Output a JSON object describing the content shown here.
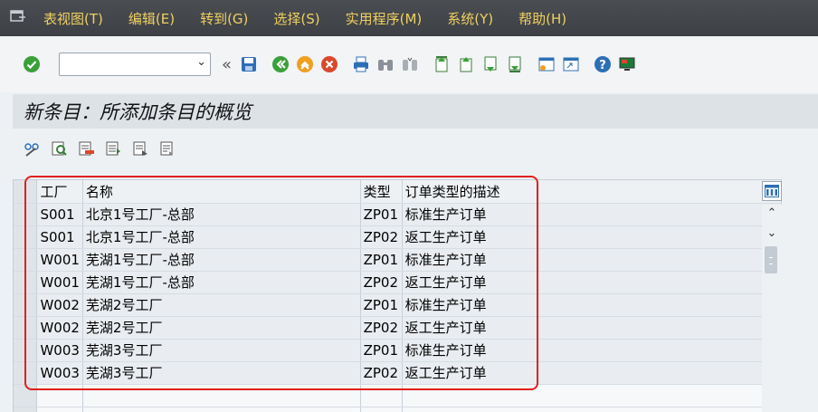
{
  "menu": {
    "items": [
      {
        "label": "表视图(T)"
      },
      {
        "label": "编辑(E)"
      },
      {
        "label": "转到(G)"
      },
      {
        "label": "选择(S)"
      },
      {
        "label": "实用程序(M)"
      },
      {
        "label": "系统(Y)"
      },
      {
        "label": "帮助(H)"
      }
    ]
  },
  "toolbar": {
    "command_value": "",
    "collapse_label": "«"
  },
  "page": {
    "title": "新条目：所添加条目的概览"
  },
  "table": {
    "headers": {
      "plant": "工厂",
      "name": "名称",
      "type": "类型",
      "desc": "订单类型的描述"
    },
    "rows": [
      {
        "plant": "S001",
        "name": "北京1号工厂-总部",
        "type": "ZP01",
        "desc": "标准生产订单"
      },
      {
        "plant": "S001",
        "name": "北京1号工厂-总部",
        "type": "ZP02",
        "desc": "返工生产订单"
      },
      {
        "plant": "W001",
        "name": "芜湖1号工厂-总部",
        "type": "ZP01",
        "desc": "标准生产订单"
      },
      {
        "plant": "W001",
        "name": "芜湖1号工厂-总部",
        "type": "ZP02",
        "desc": "返工生产订单"
      },
      {
        "plant": "W002",
        "name": "芜湖2号工厂",
        "type": "ZP01",
        "desc": "标准生产订单"
      },
      {
        "plant": "W002",
        "name": "芜湖2号工厂",
        "type": "ZP02",
        "desc": "返工生产订单"
      },
      {
        "plant": "W003",
        "name": "芜湖3号工厂",
        "type": "ZP01",
        "desc": "标准生产订单"
      },
      {
        "plant": "W003",
        "name": "芜湖3号工厂",
        "type": "ZP02",
        "desc": "返工生产订单"
      }
    ]
  },
  "colors": {
    "menubar_bg": "#3d4045",
    "menu_text": "#f0d060",
    "highlight": "#e02020"
  }
}
